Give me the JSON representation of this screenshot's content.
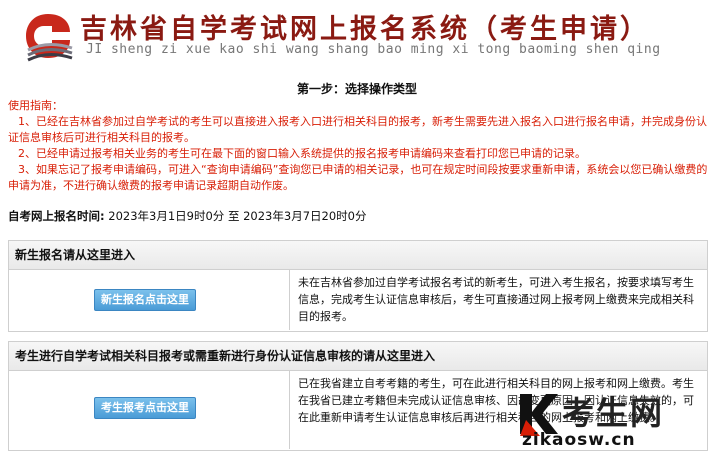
{
  "header": {
    "title": "吉林省自学考试网上报名系统（考生申请）",
    "subtitle": "JI sheng zi xue kao shi wang shang bao ming xi tong baoming shen qing"
  },
  "step_title": "第一步：选择操作类型",
  "guide": {
    "heading": "使用指南：",
    "items": [
      "1、已经在吉林省参加过自学考试的考生可以直接进入报考入口进行相关科目的报考，新考生需要先进入报名入口进行报名申请，并完成身份认证信息审核后可进行相关科目的报考。",
      "2、已经申请过报考相关业务的考生可在最下面的窗口输入系统提供的报名报考申请编码来查看打印您已申请的记录。",
      "3、如果忘记了报考申请编码，可进入“查询申请编码”查询您已申请的相关记录，也可在规定时间段按要求重新申请，系统会以您已确认缴费的申请为准，不进行确认缴费的报考申请记录超期自动作废。"
    ]
  },
  "registration_time": {
    "label": "自考网上报名时间:",
    "value": "2023年3月1日9时0分 至 2023年3月7日20时0分"
  },
  "sections": [
    {
      "header": "新生报名请从这里进入",
      "button": "新生报名点击这里",
      "description": "未在吉林省参加过自学考试报名考试的新考生，可进入考生报名，按要求填写考生信息，完成考生认证信息审核后，考生可直接通过网上报考网上缴费来完成相关科目的报考。"
    },
    {
      "header": "考生进行自学考试相关科目报考或需重新进行身份认证信息审核的请从这里进入",
      "button": "考生报考点击这里",
      "description": "已在我省建立自考考籍的考生，可在此进行相关科目的网上报考和网上缴费。考生在我省已建立考籍但未完成认证信息审核、因故变更原因，因认证信息失效的，可在此重新申请考生认证信息审核后再进行相关科目的网上报考和网上缴费。"
    }
  ],
  "watermark": {
    "text": "考生网",
    "url": "zikaosw.cn"
  },
  "colors": {
    "title": "#8a1a12",
    "guide": "#d81e06",
    "button": "#4a9bd6"
  }
}
